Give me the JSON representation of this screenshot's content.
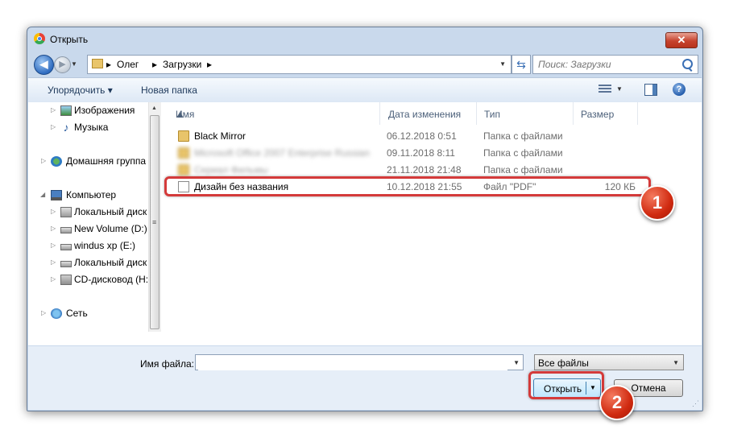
{
  "window": {
    "title": "Открыть"
  },
  "address": {
    "path": [
      "Олег",
      "Загрузки"
    ],
    "search_placeholder": "Поиск: Загрузки"
  },
  "toolbar": {
    "organize": "Упорядочить ▾",
    "new_folder": "Новая папка"
  },
  "nav": {
    "items": [
      {
        "label": "Изображения",
        "icon": "pictures-icon"
      },
      {
        "label": "Музыка",
        "icon": "music-icon"
      },
      {
        "label": "Домашняя группа",
        "icon": "homegroup-icon"
      },
      {
        "label": "Компьютер",
        "icon": "computer-icon"
      },
      {
        "label": "Локальный диск",
        "icon": "system-drive-icon"
      },
      {
        "label": "New Volume (D:)",
        "icon": "drive-icon"
      },
      {
        "label": "windus xp (E:)",
        "icon": "drive-icon"
      },
      {
        "label": "Локальный диск",
        "icon": "drive-icon"
      },
      {
        "label": "CD-дисковод (H:",
        "icon": "cd-drive-icon"
      },
      {
        "label": "Сеть",
        "icon": "network-icon"
      }
    ]
  },
  "columns": {
    "name": "Имя",
    "date": "Дата изменения",
    "type": "Тип",
    "size": "Размер"
  },
  "files": [
    {
      "name": "Black Mirror",
      "date": "06.12.2018 0:51",
      "type": "Папка с файлами",
      "size": ""
    },
    {
      "name": "Microsoft Office 2007 Enterprise Russian",
      "date": "09.11.2018 8:11",
      "type": "Папка с файлами",
      "size": ""
    },
    {
      "name": "Сериал Фильмы",
      "date": "21.11.2018 21:48",
      "type": "Папка с файлами",
      "size": ""
    },
    {
      "name": "Дизайн без названия",
      "date": "10.12.2018 21:55",
      "type": "Файл \"PDF\"",
      "size": "120 КБ"
    }
  ],
  "footer": {
    "filename_label": "Имя файла:",
    "filename_value": "",
    "filter_value": "Все файлы",
    "open_label": "Открыть",
    "cancel_label": "Отмена"
  },
  "annotations": {
    "step1": "1",
    "step2": "2"
  },
  "colors": {
    "highlight": "#d43a3a",
    "badge": "#d02a10",
    "chrome": "#c9d9ec"
  }
}
